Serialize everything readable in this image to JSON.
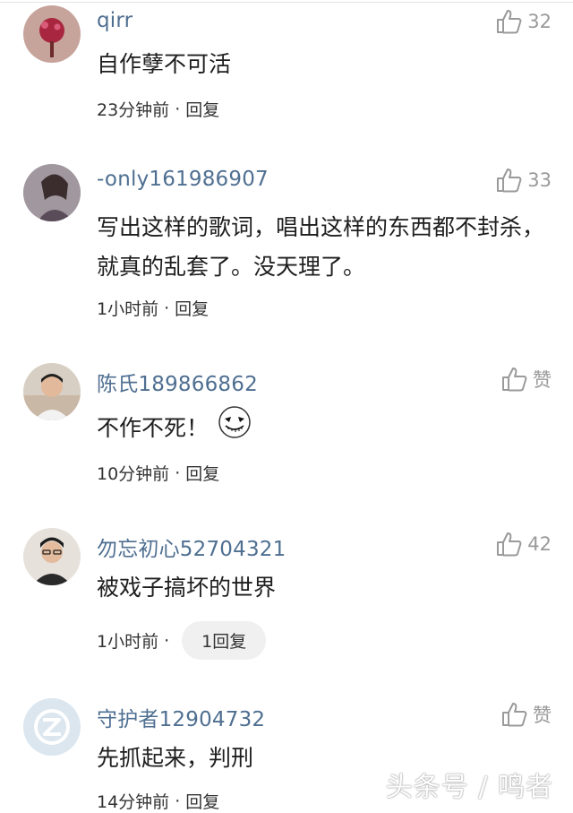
{
  "comments": [
    {
      "username": "qirr",
      "likes": "32",
      "text": "自作孽不可活",
      "time": "23分钟前",
      "sep": "·",
      "reply": "回复",
      "avatar_color": "#c7a49b"
    },
    {
      "username": "-only161986907",
      "likes": "33",
      "text": "写出这样的歌词，唱出这样的东西都不封杀，就真的乱套了。没天理了。",
      "time": "1小时前",
      "sep": "·",
      "reply": "回复",
      "avatar_color": "#8f8590"
    },
    {
      "username": "陈氏189866862",
      "likes": "赞",
      "text": "不作不死！",
      "emoji": "jack-skellington-face",
      "time": "10分钟前",
      "sep": "·",
      "reply": "回复",
      "avatar_color": "#c9b8a6"
    },
    {
      "username": "勿忘初心52704321",
      "likes": "42",
      "text": "被戏子搞坏的世界",
      "time": "1小时前",
      "sep": "·",
      "reply": "1回复",
      "avatar_color": "#cfc6bd"
    },
    {
      "username": "守护者12904732",
      "likes": "赞",
      "text": "先抓起来，判刑",
      "time": "14分钟前",
      "sep": "·",
      "reply": "回复",
      "avatar_color": "#dbe6ef"
    }
  ],
  "watermark": "头条号 / 鸣者",
  "colors": {
    "username": "#4f6f91",
    "meta": "#333333",
    "like": "#9a9a9a"
  },
  "icons": {
    "like": "thumbs-up-icon"
  }
}
